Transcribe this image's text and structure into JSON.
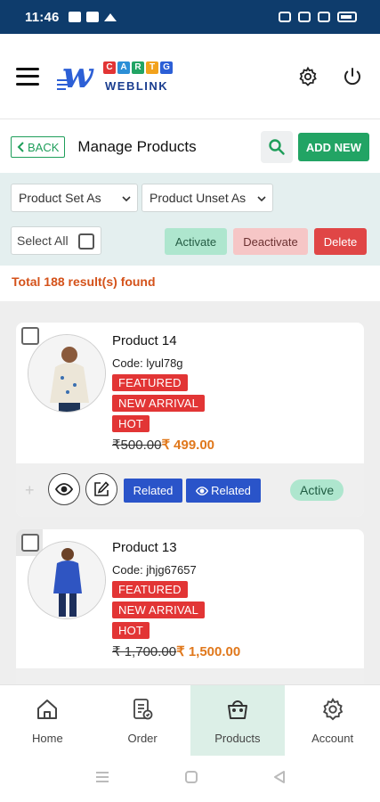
{
  "status_bar": {
    "time": "11:46"
  },
  "header": {
    "logo": {
      "cart_letters": [
        "C",
        "A",
        "R",
        "T",
        "G"
      ],
      "cart_colors": [
        "#e23535",
        "#2c8fd6",
        "#22a464",
        "#f2a21c",
        "#2c5fd6"
      ],
      "brand_text": "WEBLINK"
    },
    "icons": [
      "menu-icon",
      "gear-icon",
      "power-icon"
    ]
  },
  "title_row": {
    "back_label": "BACK",
    "title": "Manage Products",
    "add_new_label": "ADD NEW"
  },
  "filters": {
    "set_as": "Product Set As",
    "unset_as": "Product Unset As",
    "select_all": "Select All",
    "activate": "Activate",
    "deactivate": "Deactivate",
    "delete": "Delete"
  },
  "results": {
    "count_text": "Total 188 result(s) found"
  },
  "products": [
    {
      "name": "Product 14",
      "code_label": "Code:",
      "code": "lyul78g",
      "tags": [
        "FEATURED",
        "NEW ARRIVAL",
        "HOT"
      ],
      "price_old": "₹500.00",
      "price_new": "₹ 499.00",
      "related_label": "Related",
      "related_view_label": "Related",
      "status": "Active"
    },
    {
      "name": "Product 13",
      "code_label": "Code:",
      "code": "jhjg67657",
      "tags": [
        "FEATURED",
        "NEW ARRIVAL",
        "HOT"
      ],
      "price_old": "₹ 1,700.00",
      "price_new": "₹ 1,500.00"
    }
  ],
  "bottom_nav": [
    {
      "label": "Home",
      "icon": "home-icon"
    },
    {
      "label": "Order",
      "icon": "order-icon"
    },
    {
      "label": "Products",
      "icon": "bag-icon",
      "active": true
    },
    {
      "label": "Account",
      "icon": "gear-icon"
    }
  ],
  "colors": {
    "primary_green": "#22a464",
    "header_blue": "#0e3c6c",
    "tag_red": "#e23535",
    "price_orange": "#e0781c",
    "related_blue": "#2a54c9"
  }
}
